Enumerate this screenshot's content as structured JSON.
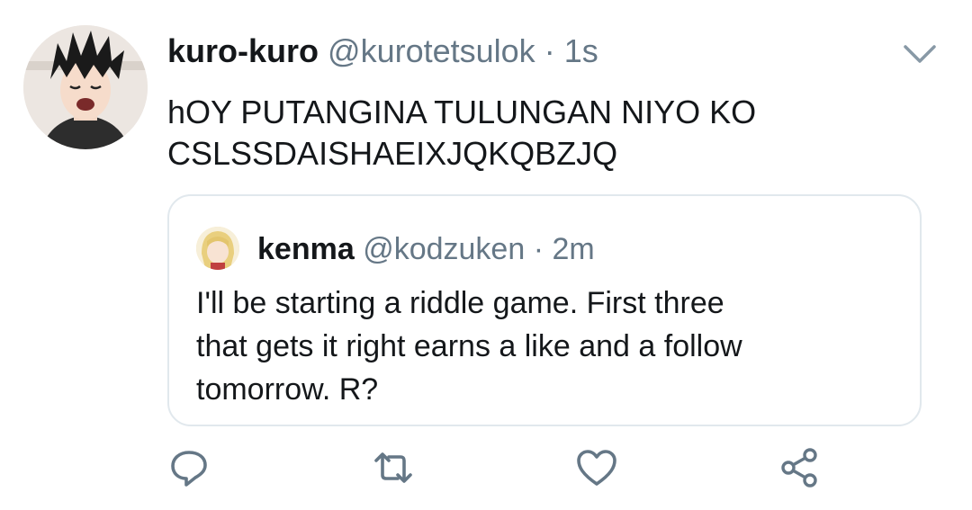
{
  "tweet": {
    "display_name": "kuro-kuro",
    "handle": "@kurotetsulok",
    "separator": " · ",
    "time": "1s",
    "text_line1": "hOY PUTANGINA TULUNGAN NIYO KO",
    "text_line2": "CSLSSDAISHAEIXJQKQBZJQ"
  },
  "quoted_tweet": {
    "display_name": "kenma",
    "handle": "@kodzuken",
    "separator": " · ",
    "time": "2m",
    "text_line1": "I'll be starting a riddle game. First three",
    "text_line2": "that gets it right earns a like and a follow",
    "text_line3": "tomorrow. R?"
  },
  "actions": {
    "icons": [
      "reply-icon",
      "retweet-icon",
      "like-icon",
      "share-icon"
    ]
  },
  "colors": {
    "text": "#14171a",
    "secondary": "#657786",
    "border": "#e1e8ed"
  }
}
